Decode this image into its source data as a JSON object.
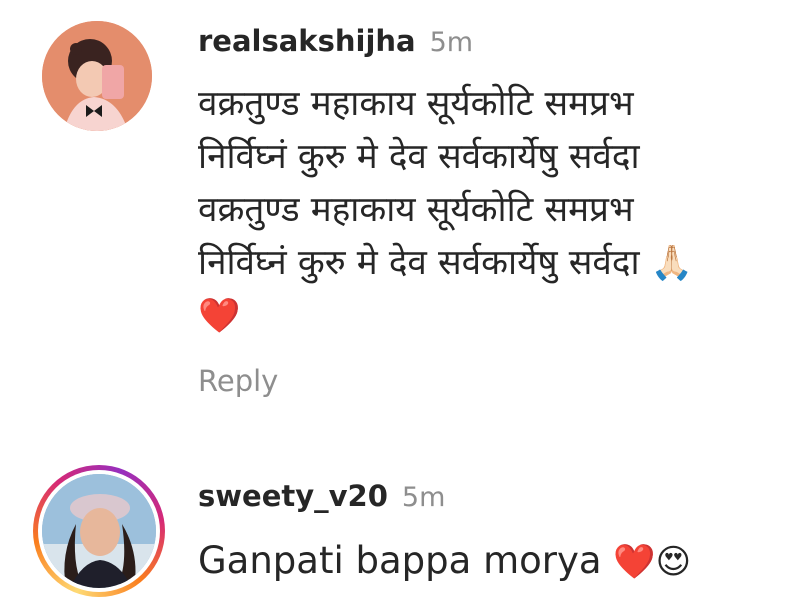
{
  "comments": [
    {
      "username": "realsakshijha",
      "time": "5m",
      "lines": [
        "वक्रतुण्ड महाकाय सूर्यकोटि समप्रभ",
        "निर्विघ्नं कुरु मे देव सर्वकार्येषु सर्वदा",
        "वक्रतुण्ड महाकाय सूर्यकोटि समप्रभ",
        "निर्विघ्नं कुरु मे देव सर्वकार्येषु सर्वदा"
      ],
      "emoji_inline": "🙏🏻",
      "emoji_line": "❤️",
      "reply_label": "Reply",
      "avatar_icon": "profile-photo-selfie"
    },
    {
      "username": "sweety_v20",
      "time": "5m",
      "text": "Ganpati bappa morya",
      "emoji": "❤️😍",
      "avatar_icon": "profile-photo-with-story-ring",
      "story_ring_colors": [
        "#feda75",
        "#fa7e1e",
        "#d62976",
        "#962fbf"
      ]
    }
  ]
}
